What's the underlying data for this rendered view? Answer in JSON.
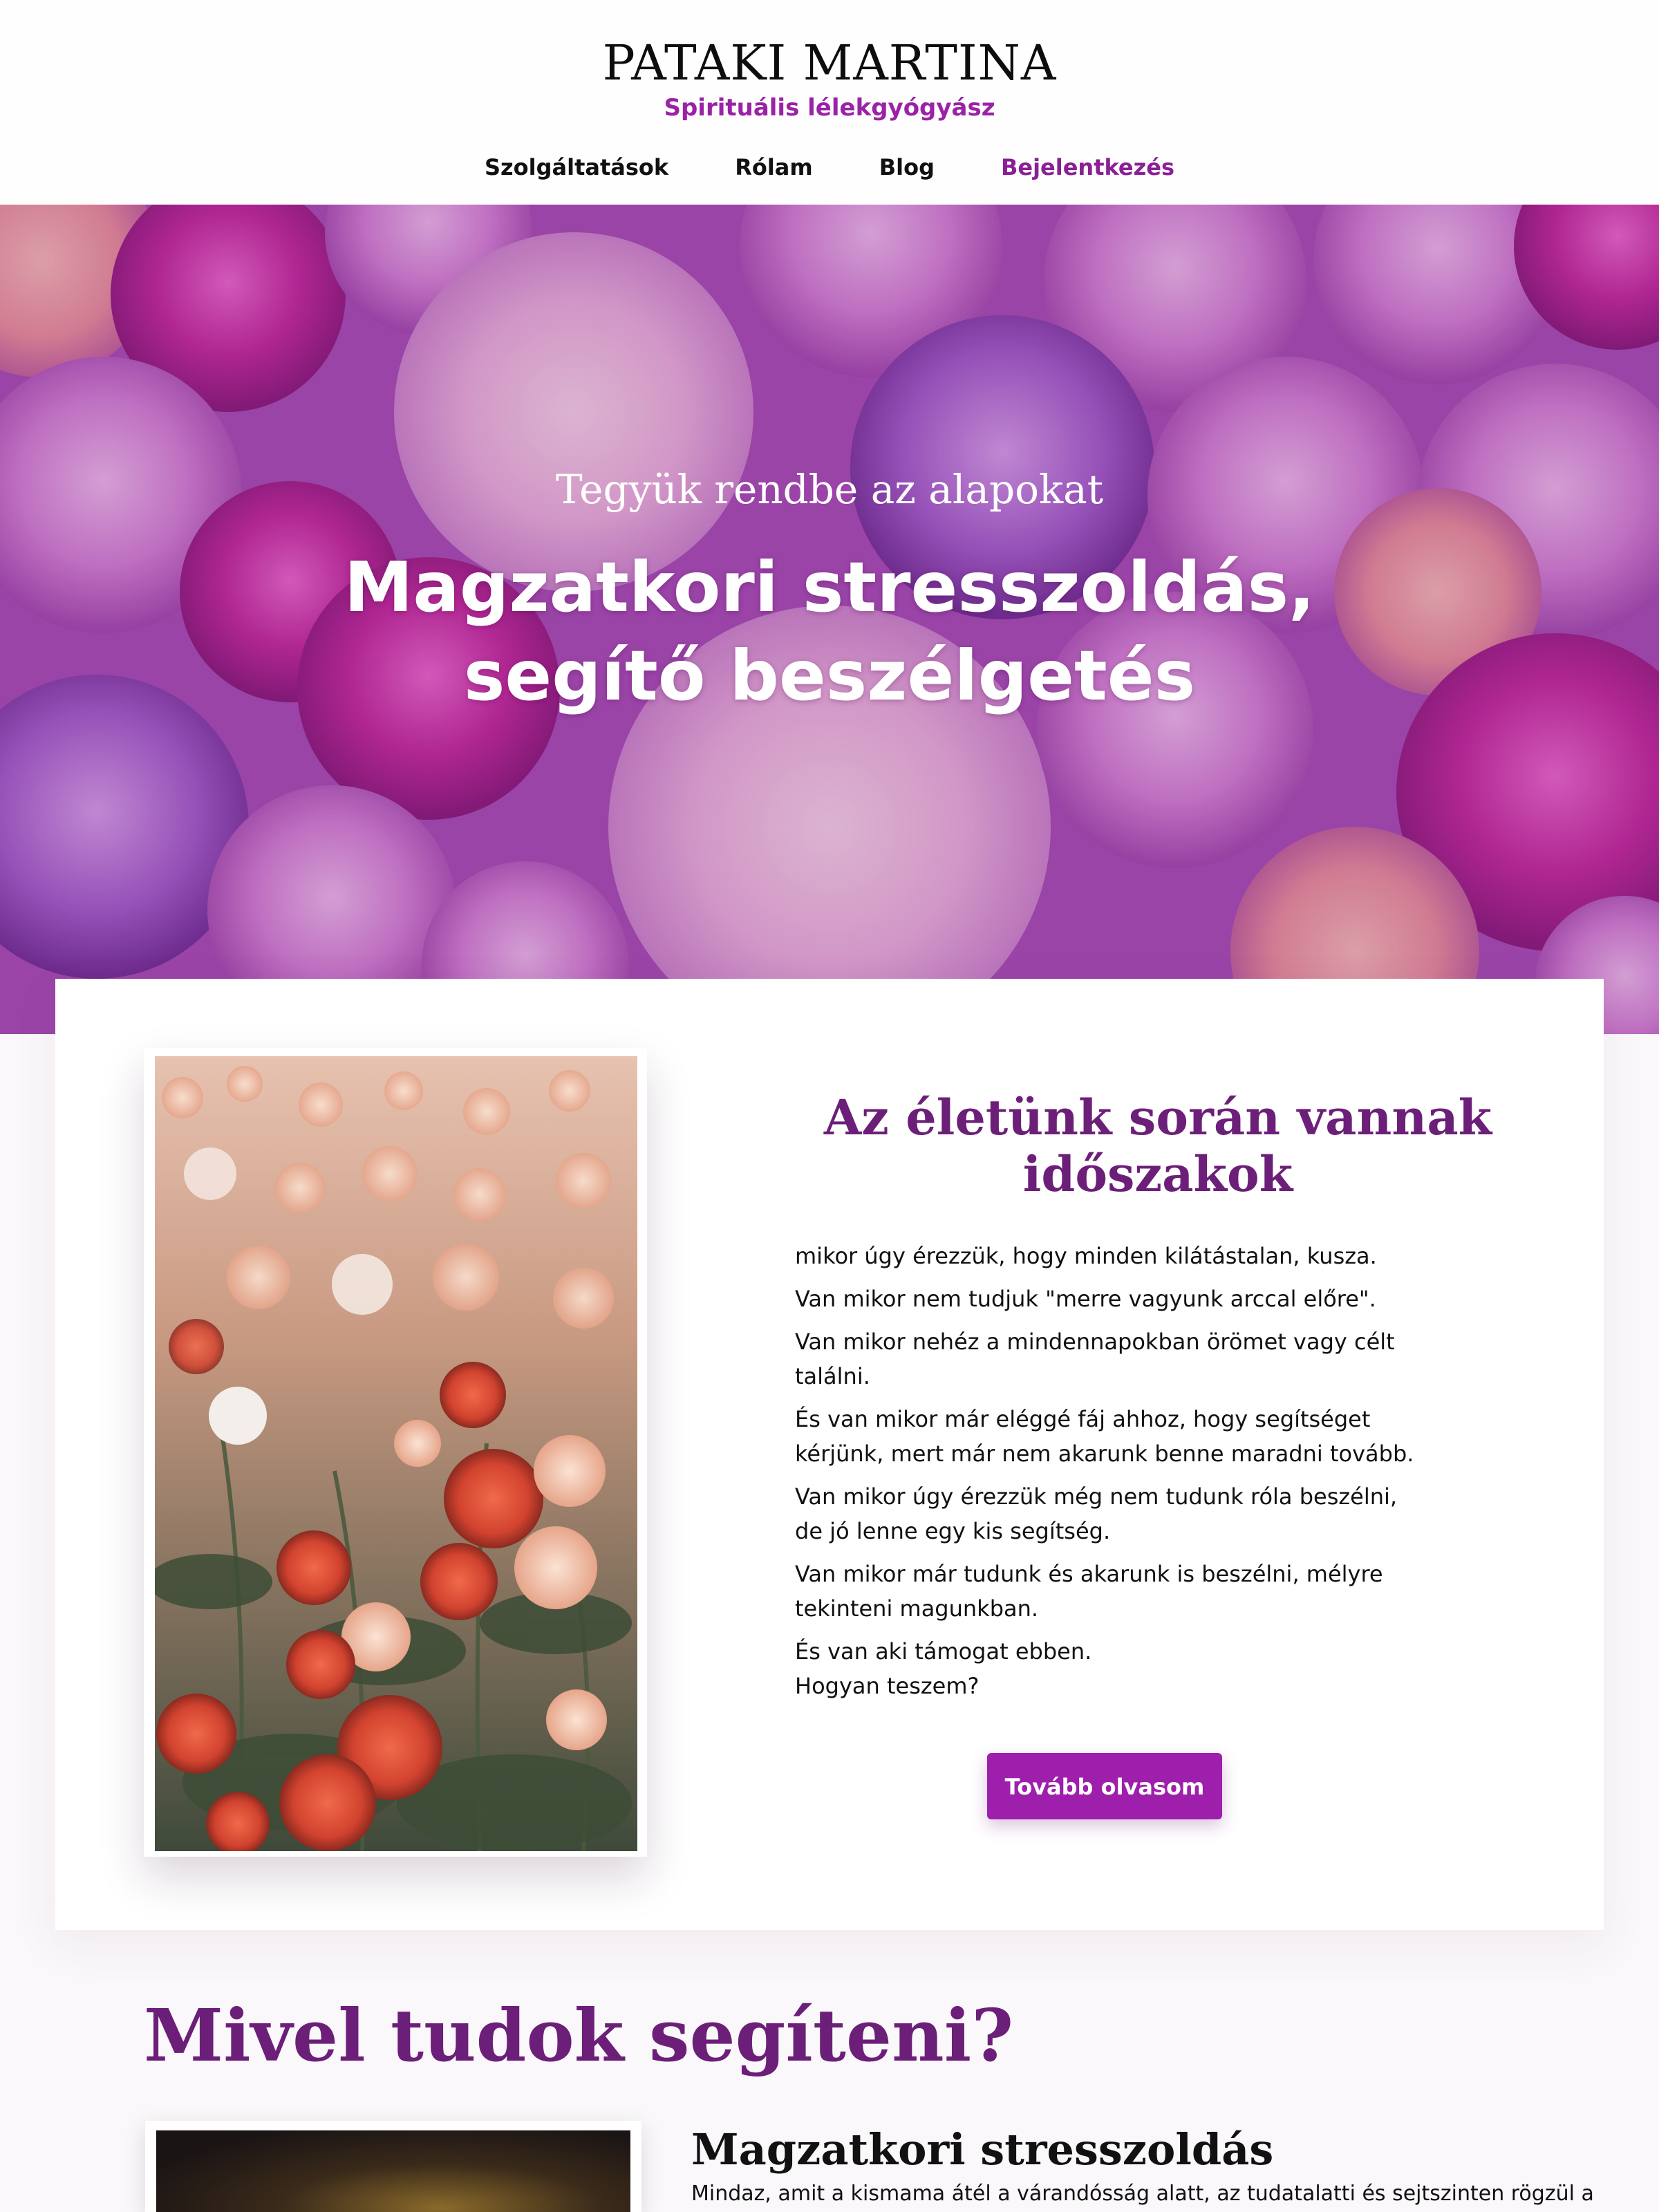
{
  "header": {
    "brand": "PATAKI MARTINA",
    "tagline": "Spirituális lélekgyógyász",
    "nav": [
      {
        "label": "Szolgáltatások"
      },
      {
        "label": "Rólam"
      },
      {
        "label": "Blog"
      },
      {
        "label": "Bejelentkezés"
      }
    ]
  },
  "hero": {
    "kicker": "Tegyük rendbe az alapokat",
    "title_line1": "Magzatkori stresszoldás,",
    "title_line2": "segítő beszélgetés"
  },
  "intro": {
    "title": "Az életünk során vannak időszakok",
    "paragraphs": [
      "mikor úgy érezzük, hogy minden kilátástalan, kusza.",
      "Van mikor nem tudjuk \"merre vagyunk arccal előre\".",
      "Van mikor nehéz a mindennapokban örömet vagy célt találni.",
      "És van mikor már eléggé fáj ahhoz, hogy segítséget kérjünk, mert már nem akarunk benne maradni tovább.",
      "Van mikor úgy érezzük még nem tudunk róla beszélni, de jó lenne egy kis segítség.",
      "Van mikor már tudunk és akarunk is beszélni, mélyre tekinteni magunkban."
    ],
    "closing_line1": "És van aki támogat ebben.",
    "closing_line2": "Hogyan teszem?",
    "cta_label": "Tovább olvasom"
  },
  "services": {
    "title": "Mivel tudok segíteni?",
    "items": [
      {
        "title": "Magzatkori stresszoldás",
        "text": "Mindaz, amit a kismama átél a várandósság alatt, az tudatalatti és sejtszinten rögzül a"
      }
    ]
  },
  "colors": {
    "accent": "#9e1fac",
    "heading": "#6c1f78",
    "nav_active": "#8a1f96"
  }
}
